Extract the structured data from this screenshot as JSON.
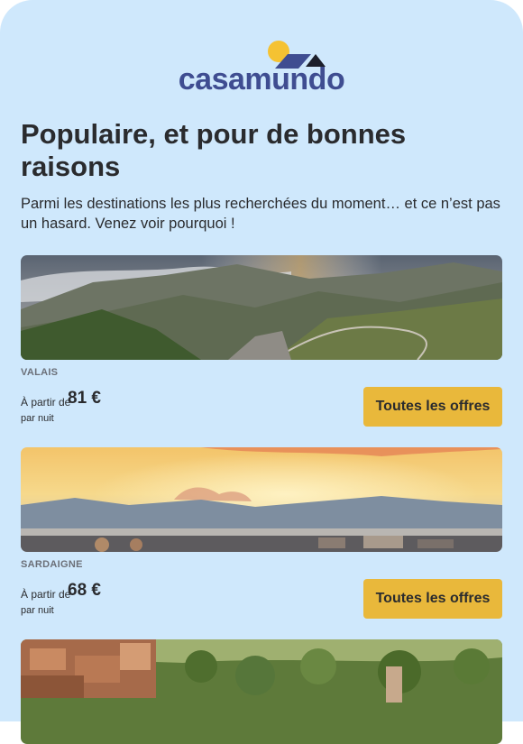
{
  "brand": {
    "logo_text": "casamundo"
  },
  "headline": "Populaire, et pour de bonnes raisons",
  "intro": "Parmi les destinations les plus recherchées du moment… et ce n’est pas un hasard. Venez voir pourquoi !",
  "destinations": [
    {
      "name": "VALAIS",
      "from_label": "À partir de",
      "price": "81 €",
      "per_night": "par nuit",
      "button_label": "Toutes les offres",
      "image": "mountain-valley-photo"
    },
    {
      "name": "SARDAIGNE",
      "from_label": "À partir de",
      "price": "68 €",
      "per_night": "par nuit",
      "button_label": "Toutes les offres",
      "image": "coastal-sunset-photo"
    },
    {
      "image": "hill-town-photo"
    }
  ],
  "colors": {
    "background": "#cfe8fc",
    "brand": "#3f4d91",
    "sun": "#f5c232",
    "button": "#e9b83b",
    "text": "#2a2b2e"
  }
}
